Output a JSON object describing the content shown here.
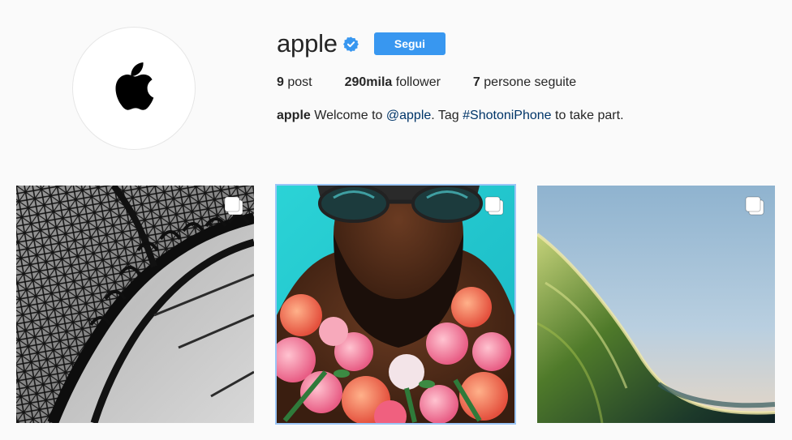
{
  "profile": {
    "username": "apple",
    "verified_icon": "verified-badge-icon",
    "follow_label": "Segui",
    "avatar_icon": "apple-logo-icon"
  },
  "stats": {
    "posts_count": "9",
    "posts_label": "post",
    "followers_count": "290mila",
    "followers_label": "follower",
    "following_count": "7",
    "following_label": "persone seguite"
  },
  "bio": {
    "name": "apple",
    "text_1": "Welcome to",
    "mention": "@apple",
    "text_2": ". Tag",
    "hashtag": "#ShotoniPhone",
    "text_3": "to take part."
  },
  "posts": [
    {
      "subject": "eiffel-tower-black-and-white",
      "icon": "multiple-photos-icon"
    },
    {
      "subject": "man-with-sunglasses-and-roses",
      "icon": "multiple-photos-icon",
      "selected": true
    },
    {
      "subject": "ocean-wave",
      "icon": "multiple-photos-icon"
    }
  ],
  "colors": {
    "accent": "#3897f0",
    "link": "#003569",
    "background": "#fafafa",
    "text": "#262626"
  }
}
